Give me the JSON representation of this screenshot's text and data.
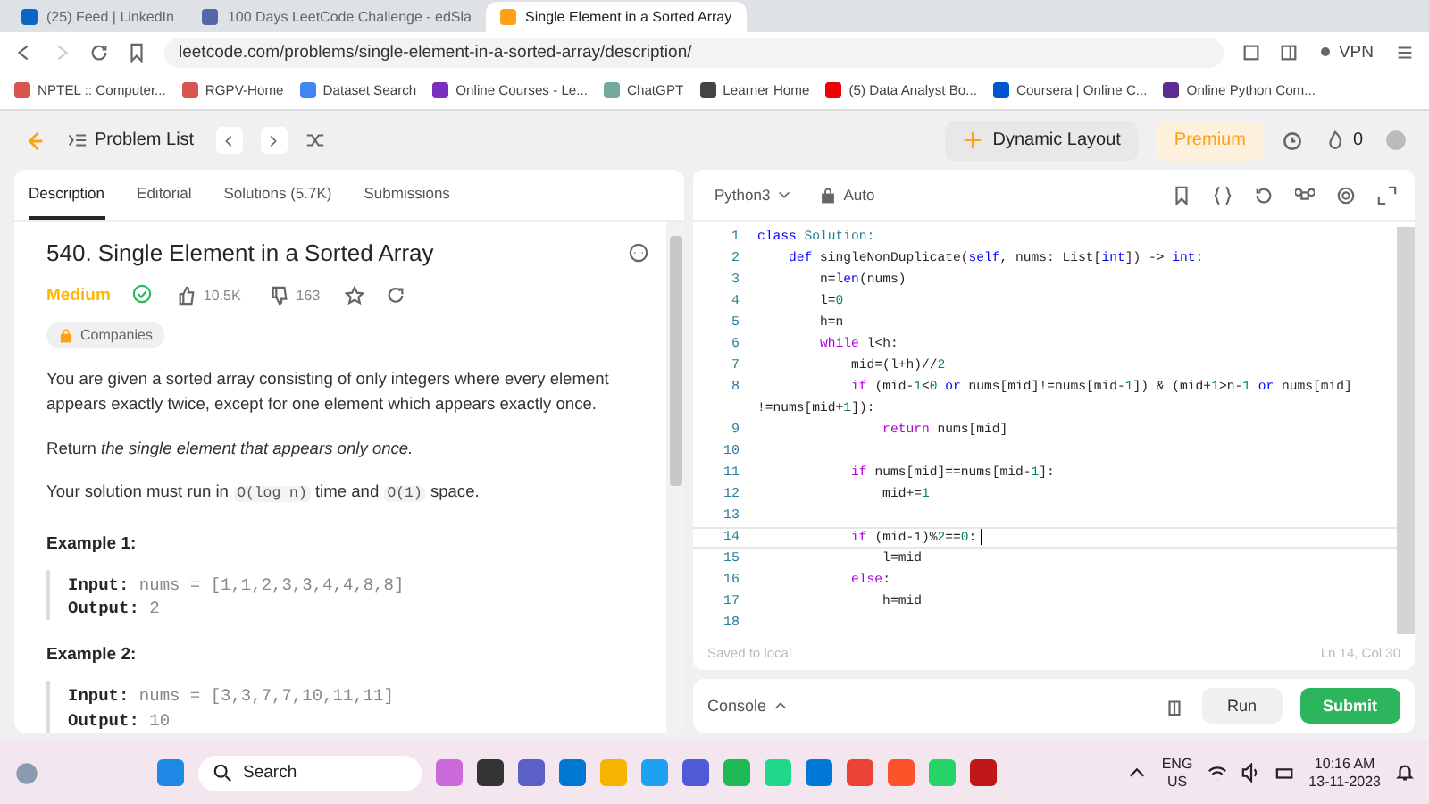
{
  "browser": {
    "tabs": [
      {
        "title": "(25) Feed | LinkedIn",
        "selected": false
      },
      {
        "title": "100 Days LeetCode Challenge - edSla",
        "selected": false
      },
      {
        "title": "Single Element in a Sorted Array",
        "selected": true
      }
    ],
    "address": "leetcode.com/problems/single-element-in-a-sorted-array/description/",
    "vpn": "VPN",
    "bookmarks": [
      "NPTEL :: Computer...",
      "RGPV-Home",
      "Dataset Search",
      "Online Courses - Le...",
      "ChatGPT",
      "Learner Home",
      "(5) Data Analyst Bo...",
      "Coursera | Online C...",
      "Online Python Com..."
    ]
  },
  "header": {
    "problem_list": "Problem List",
    "dynamic_layout": "Dynamic Layout",
    "premium": "Premium",
    "streak": "0"
  },
  "left_panel": {
    "tabs": [
      {
        "label": "Description",
        "selected": true
      },
      {
        "label": "Editorial",
        "selected": false
      },
      {
        "label": "Solutions (5.7K)",
        "selected": false
      },
      {
        "label": "Submissions",
        "selected": false
      }
    ],
    "title": "540. Single Element in a Sorted Array",
    "difficulty": "Medium",
    "solved": true,
    "likes": "10.5K",
    "dislikes": "163",
    "companies": "Companies",
    "paragraphs": [
      [
        {
          "text": "You are given a sorted array consisting of only integers where every element appears exactly twice, except for one element which appears exactly once."
        }
      ],
      [
        {
          "text": "Return "
        },
        {
          "text": "the single element that appears only once.",
          "kind": "italic"
        }
      ],
      [
        {
          "text": "Your solution must run in "
        },
        {
          "text": "O(log n)",
          "kind": "code"
        },
        {
          "text": " time and "
        },
        {
          "text": "O(1)",
          "kind": "code"
        },
        {
          "text": " space."
        }
      ]
    ],
    "examples": [
      {
        "title": "Example 1:",
        "input_label": "Input:",
        "input": "nums = [1,1,2,3,3,4,4,8,8]",
        "output_label": "Output:",
        "output": "2"
      },
      {
        "title": "Example 2:",
        "input_label": "Input:",
        "input": "nums = [3,3,7,7,10,11,11]",
        "output_label": "Output:",
        "output": "10"
      }
    ]
  },
  "editor": {
    "language": "Python3",
    "mode": "Auto",
    "lines": [
      {
        "number": "1",
        "segments": [
          {
            "text": "class ",
            "kind": "kw"
          },
          {
            "text": "Solution:",
            "kind": "type"
          }
        ]
      },
      {
        "number": "2",
        "segments": [
          {
            "text": "    def ",
            "kind": "kw"
          },
          {
            "text": "singleNonDuplicate(",
            "kind": "plain"
          },
          {
            "text": "self",
            "kind": "kw"
          },
          {
            "text": ", nums: List[",
            "kind": "plain"
          },
          {
            "text": "int",
            "kind": "kw"
          },
          {
            "text": "]) -> "
          },
          {
            "text": "int",
            "kind": "kw"
          },
          {
            "text": ":"
          }
        ]
      },
      {
        "number": "3",
        "segments": [
          {
            "text": "        n="
          },
          {
            "text": "len",
            "kind": "kw"
          },
          {
            "text": "(nums)"
          }
        ]
      },
      {
        "number": "4",
        "segments": [
          {
            "text": "        l="
          },
          {
            "text": "0",
            "kind": "num"
          }
        ]
      },
      {
        "number": "5",
        "segments": [
          {
            "text": "        h=n"
          }
        ]
      },
      {
        "number": "6",
        "segments": [
          {
            "text": "        while",
            "kind": "ctl"
          },
          {
            "text": " l<h:"
          }
        ]
      },
      {
        "number": "7",
        "segments": [
          {
            "text": "            mid=(l+h)//"
          },
          {
            "text": "2",
            "kind": "num"
          }
        ]
      },
      {
        "number": "8",
        "segments": [
          {
            "text": "            if",
            "kind": "ctl"
          },
          {
            "text": " (mid-"
          },
          {
            "text": "1",
            "kind": "num"
          },
          {
            "text": "<"
          },
          {
            "text": "0",
            "kind": "num"
          },
          {
            "text": " or",
            "kind": "kw"
          },
          {
            "text": " nums[mid]!=nums[mid-"
          },
          {
            "text": "1",
            "kind": "num"
          },
          {
            "text": "]) & (mid+"
          },
          {
            "text": "1",
            "kind": "num"
          },
          {
            "text": ">n-"
          },
          {
            "text": "1",
            "kind": "num"
          },
          {
            "text": " or",
            "kind": "kw"
          },
          {
            "text": " nums[mid]"
          }
        ]
      },
      {
        "segments": [
          {
            "text": "!=nums[mid+"
          },
          {
            "text": "1",
            "kind": "num"
          },
          {
            "text": "]):"
          }
        ]
      },
      {
        "number": "9",
        "segments": [
          {
            "text": "                return",
            "kind": "ctl"
          },
          {
            "text": " nums[mid]"
          }
        ]
      },
      {
        "number": "10"
      },
      {
        "number": "11",
        "segments": [
          {
            "text": "            if",
            "kind": "ctl"
          },
          {
            "text": " nums[mid]==nums[mid-"
          },
          {
            "text": "1",
            "kind": "num"
          },
          {
            "text": "]:"
          }
        ]
      },
      {
        "number": "12",
        "segments": [
          {
            "text": "                mid+="
          },
          {
            "text": "1",
            "kind": "num"
          }
        ]
      },
      {
        "number": "13"
      },
      {
        "number": "14",
        "current": true,
        "segments": [
          {
            "text": "            if",
            "kind": "ctl"
          },
          {
            "text": " (mid-1)%"
          },
          {
            "text": "2",
            "kind": "num"
          },
          {
            "text": "=="
          },
          {
            "text": "0",
            "kind": "num"
          },
          {
            "text": ":"
          }
        ]
      },
      {
        "number": "15",
        "segments": [
          {
            "text": "                l=mid"
          }
        ]
      },
      {
        "number": "16",
        "segments": [
          {
            "text": "            else",
            "kind": "ctl"
          },
          {
            "text": ":"
          }
        ]
      },
      {
        "number": "17",
        "segments": [
          {
            "text": "                h=mid"
          }
        ]
      },
      {
        "number": "18"
      }
    ],
    "saved": "Saved to local",
    "cursor": "Ln 14, Col 30"
  },
  "console": {
    "label": "Console",
    "run": "Run",
    "submit": "Submit"
  },
  "taskbar": {
    "search": "Search",
    "lang": "ENG",
    "region": "US",
    "time": "10:16 AM",
    "date": "13-11-2023"
  }
}
